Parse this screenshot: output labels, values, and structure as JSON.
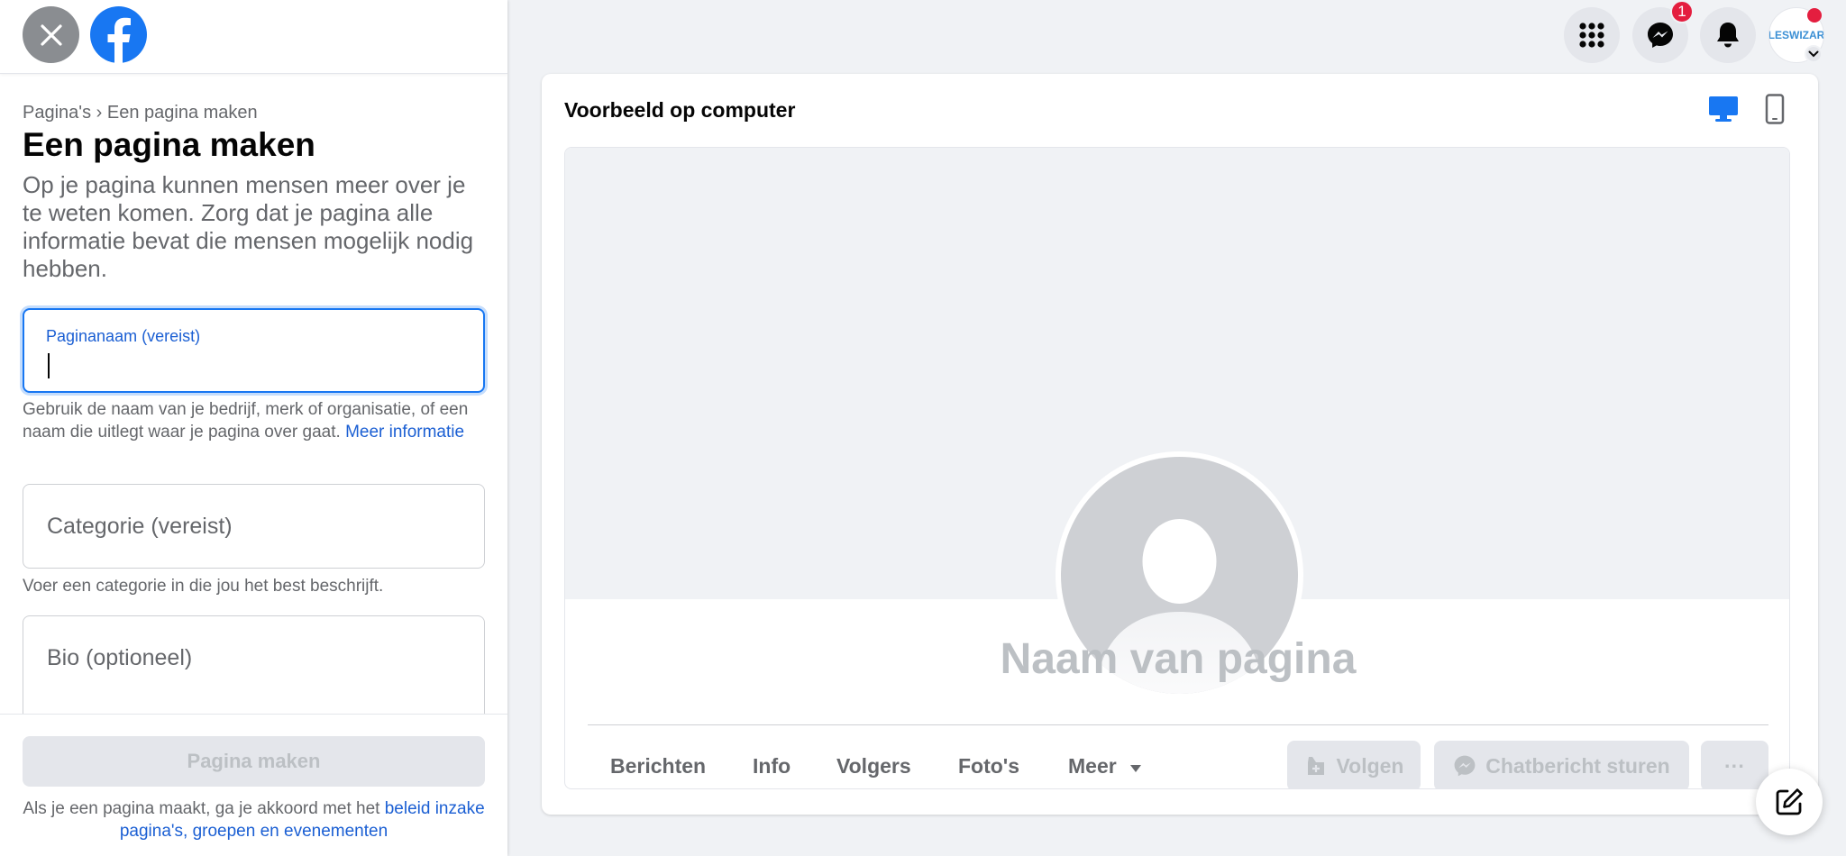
{
  "left_panel": {
    "breadcrumb": {
      "parent": "Pagina's",
      "separator": "›",
      "current": "Een pagina maken"
    },
    "title": "Een pagina maken",
    "description": "Op je pagina kunnen mensen meer over je te weten komen. Zorg dat je pagina alle informatie bevat die mensen mogelijk nodig hebben.",
    "name_field": {
      "label": "Paginanaam (vereist)",
      "value": "",
      "help": "Gebruik de naam van je bedrijf, merk of organisatie, of een naam die uitlegt waar je pagina over gaat.",
      "help_link": "Meer informatie"
    },
    "category_field": {
      "placeholder": "Categorie (vereist)",
      "help": "Voer een categorie in die jou het best beschrijft."
    },
    "bio_field": {
      "placeholder": "Bio (optioneel)"
    },
    "create_button": "Pagina maken",
    "terms": {
      "prefix": "Als je een pagina maakt, ga je akkoord met het",
      "link": "beleid inzake pagina's, groepen en evenementen"
    }
  },
  "top_nav": {
    "messenger_badge": "1",
    "avatar_text": "LESWIZAR"
  },
  "preview": {
    "title": "Voorbeeld op computer",
    "page_name": "Naam van pagina",
    "tabs": [
      {
        "label": "Berichten"
      },
      {
        "label": "Info"
      },
      {
        "label": "Volgers"
      },
      {
        "label": "Foto's"
      },
      {
        "label": "Meer"
      }
    ],
    "follow_button": "Volgen",
    "message_button": "Chatbericht sturen",
    "more_button": "···"
  },
  "colors": {
    "accent": "#1877f2",
    "link": "#1b5fd3",
    "badge": "#e41e3f",
    "disabled_text": "#bcc0c4"
  }
}
